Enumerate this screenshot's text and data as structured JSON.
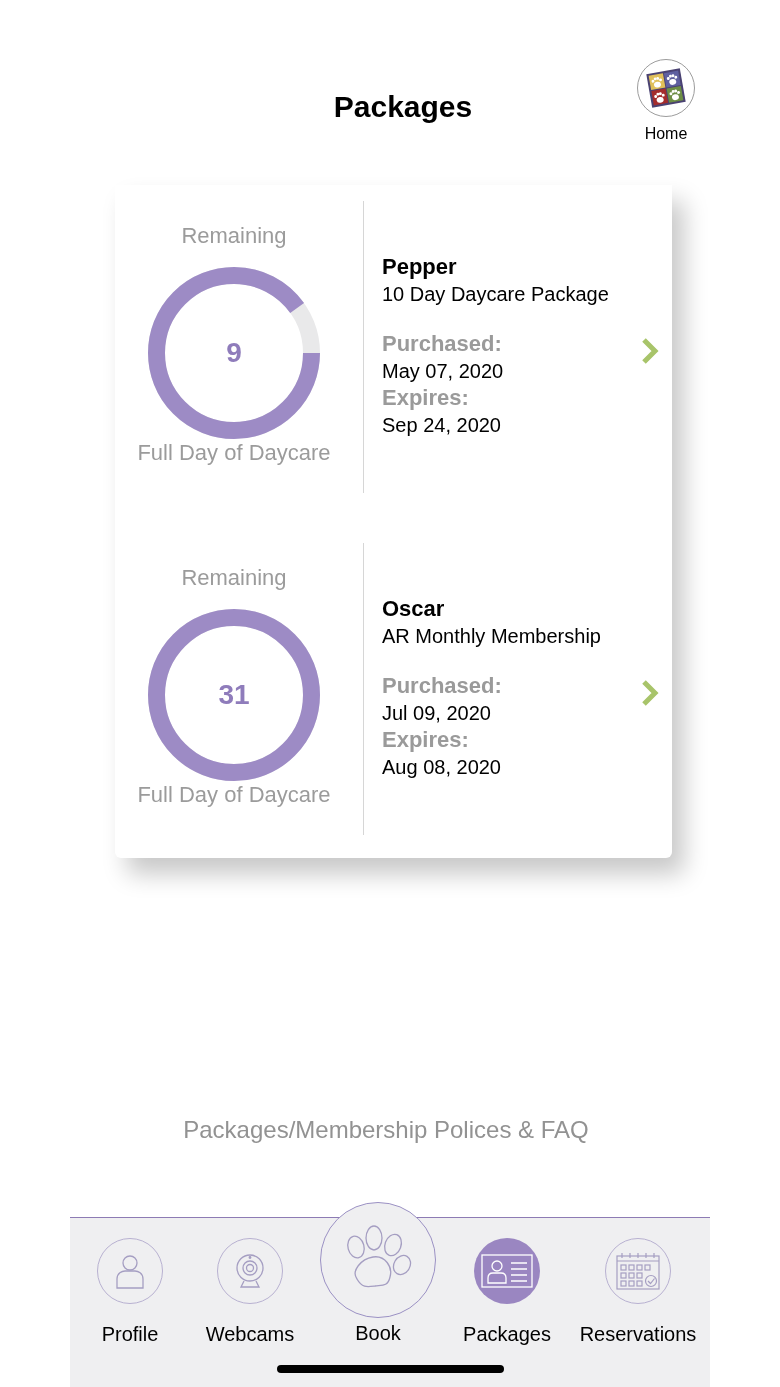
{
  "header": {
    "title": "Packages",
    "home_button": {
      "label": "Home"
    }
  },
  "packages": [
    {
      "remaining_label": "Remaining",
      "count": "9",
      "level": 0.9,
      "unit": "Full Day of Daycare",
      "pet": "Pepper",
      "plan": "10 Day Daycare Package",
      "purchased_label": "Purchased:",
      "purchased": "May 07, 2020",
      "expires_label": "Expires:",
      "expires": "Sep 24, 2020"
    },
    {
      "remaining_label": "Remaining",
      "count": "31",
      "level": 1,
      "unit": "Full Day of Daycare",
      "pet": "Oscar",
      "plan": "AR Monthly Membership",
      "purchased_label": "Purchased:",
      "purchased": "Jul 09, 2020",
      "expires_label": "Expires:",
      "expires": "Aug 08, 2020"
    }
  ],
  "policies_link": "Packages/Membership Polices & FAQ",
  "tab_bar": {
    "tabs": [
      {
        "label": "Profile",
        "kind": "profile",
        "selected": false
      },
      {
        "label": "Webcams",
        "kind": "webcams",
        "selected": false
      },
      {
        "label": "Book",
        "kind": "book",
        "selected": false
      },
      {
        "label": "Packages",
        "kind": "packages",
        "selected": true
      },
      {
        "label": "Reservations",
        "kind": "reservations",
        "selected": false
      }
    ]
  }
}
